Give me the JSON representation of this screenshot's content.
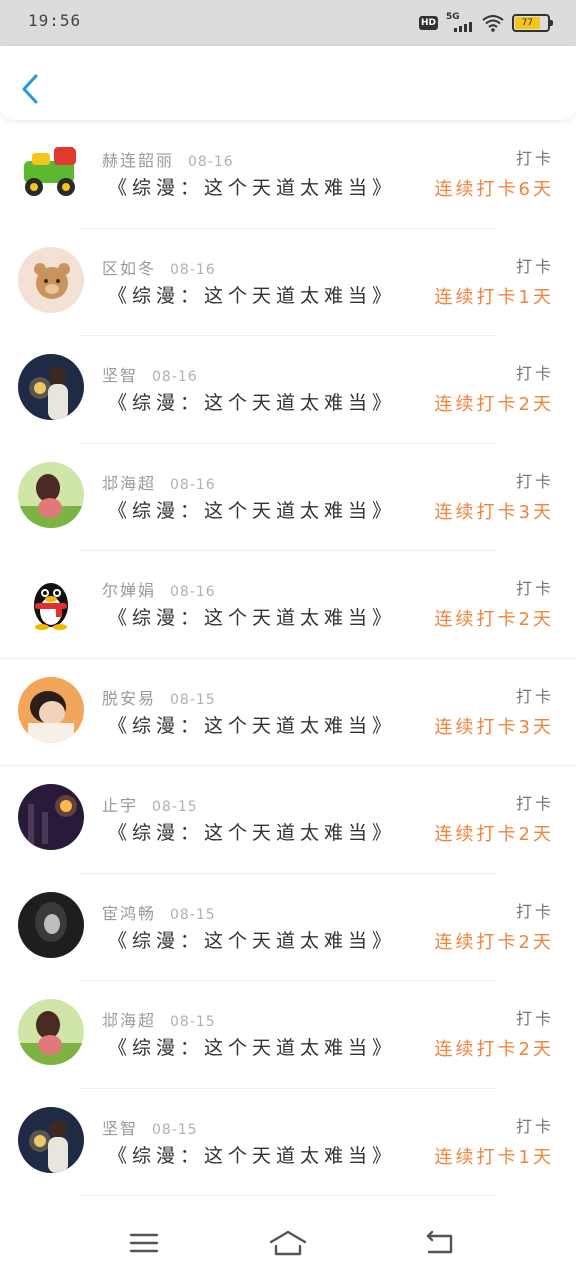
{
  "status_bar": {
    "time": "19:56",
    "hd_label": "HD",
    "network_label": "5G",
    "battery_text": "77"
  },
  "header": {
    "back_icon": "chevron-left-icon"
  },
  "colors": {
    "accent": "#1a9be8",
    "streak": "#f0843c"
  },
  "entries": [
    {
      "name": "赫连韶丽",
      "date": "08-16",
      "book": "《综漫：这个天道太难当》",
      "action": "打卡",
      "streak": "连续打卡6天",
      "avatar": "toy-car"
    },
    {
      "name": "区如冬",
      "date": "08-16",
      "book": "《综漫：这个天道太难当》",
      "action": "打卡",
      "streak": "连续打卡1天",
      "avatar": "teddy-bear"
    },
    {
      "name": "坚智",
      "date": "08-16",
      "book": "《综漫：这个天道太难当》",
      "action": "打卡",
      "streak": "连续打卡2天",
      "avatar": "sparkler-night"
    },
    {
      "name": "邶海超",
      "date": "08-16",
      "book": "《综漫：这个天道太难当》",
      "action": "打卡",
      "streak": "连续打卡3天",
      "avatar": "girl-grass"
    },
    {
      "name": "尔婵娟",
      "date": "08-16",
      "book": "《综漫：这个天道太难当》",
      "action": "打卡",
      "streak": "连续打卡2天",
      "avatar": "qq-penguin"
    },
    {
      "name": "脱安易",
      "date": "08-15",
      "book": "《综漫：这个天道太难当》",
      "action": "打卡",
      "streak": "连续打卡3天",
      "avatar": "girl-portrait"
    },
    {
      "name": "止宇",
      "date": "08-15",
      "book": "《综漫：这个天道太难当》",
      "action": "打卡",
      "streak": "连续打卡2天",
      "avatar": "night-lantern"
    },
    {
      "name": "宦鸿畅",
      "date": "08-15",
      "book": "《综漫：这个天道太难当》",
      "action": "打卡",
      "streak": "连续打卡2天",
      "avatar": "dark-portrait"
    },
    {
      "name": "邶海超",
      "date": "08-15",
      "book": "《综漫：这个天道太难当》",
      "action": "打卡",
      "streak": "连续打卡2天",
      "avatar": "girl-grass"
    },
    {
      "name": "坚智",
      "date": "08-15",
      "book": "《综漫：这个天道太难当》",
      "action": "打卡",
      "streak": "连续打卡1天",
      "avatar": "sparkler-night"
    }
  ],
  "navbar": {
    "menu_icon": "menu-icon",
    "home_icon": "home-icon",
    "back_icon": "back-arrow-icon"
  }
}
